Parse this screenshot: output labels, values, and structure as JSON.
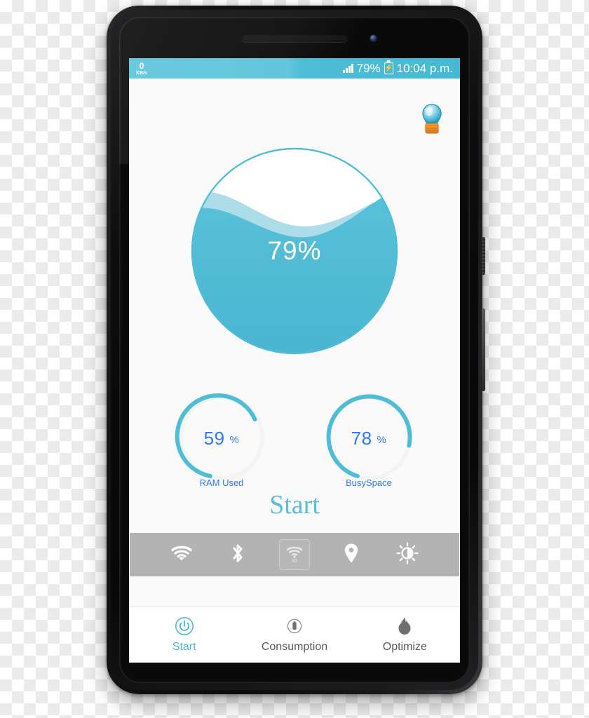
{
  "device": {
    "name": "android-smartphone"
  },
  "statusbar": {
    "net_speed_value": "0",
    "net_speed_unit": "KB/s",
    "signal_icon": "signal-bars-icon",
    "battery_percent": "79%",
    "battery_icon": "battery-charging-icon",
    "clock": "10:04 p.m.",
    "background_color": "#5bc4db"
  },
  "app": {
    "bulb_icon": "lightbulb-icon",
    "background_color": "#fafafa",
    "accent_color": "#4fbdd6",
    "value_color": "#2f7bf0"
  },
  "main_gauge": {
    "name": "battery-water-gauge",
    "value": 79,
    "label": "79%",
    "fill_color": "#4fbdd6",
    "wave_highlight_color": "#9ed7e4",
    "ring_color": "#4fbdd6"
  },
  "mini_gauges": [
    {
      "name": "ram-used-gauge",
      "value": 59,
      "value_label": "59",
      "unit": "%",
      "caption": "RAM Used",
      "arc_color": "#4fbdd6",
      "track_color": "#f2f2f2"
    },
    {
      "name": "busyspace-gauge",
      "value": 78,
      "value_label": "78",
      "unit": "%",
      "caption": "BusySpace",
      "arc_color": "#4fbdd6",
      "track_color": "#f2f2f2"
    }
  ],
  "start_action": {
    "label": "Start",
    "color": "#5bbdd6"
  },
  "quick_toolbar": {
    "background_color": "#b3b3b3",
    "items": [
      {
        "name": "wifi-toggle",
        "icon": "wifi-icon",
        "label": "",
        "selected": false
      },
      {
        "name": "bluetooth-toggle",
        "icon": "bluetooth-icon",
        "label": "",
        "selected": false
      },
      {
        "name": "mobile-data-toggle",
        "icon": "mobile-data-icon",
        "label": "3G",
        "selected": true
      },
      {
        "name": "location-toggle",
        "icon": "location-pin-icon",
        "label": "",
        "selected": false
      },
      {
        "name": "brightness-toggle",
        "icon": "brightness-icon",
        "label": "",
        "selected": false
      }
    ]
  },
  "bottom_nav": {
    "items": [
      {
        "name": "nav-start",
        "icon": "power-icon",
        "label": "Start",
        "active": true
      },
      {
        "name": "nav-consumption",
        "icon": "battery-circle-icon",
        "label": "Consumption",
        "active": false
      },
      {
        "name": "nav-optimize",
        "icon": "flame-icon",
        "label": "Optimize",
        "active": false
      }
    ]
  }
}
